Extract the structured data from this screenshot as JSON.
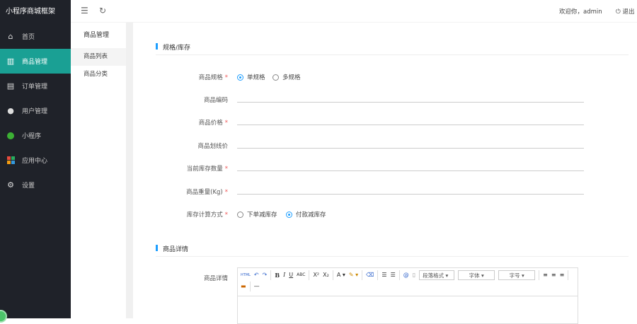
{
  "app": {
    "title": "小程序商城框架"
  },
  "sidebar": {
    "items": [
      {
        "label": "首页",
        "icon": "home-icon"
      },
      {
        "label": "商品管理",
        "icon": "gift-icon",
        "active": true
      },
      {
        "label": "订单管理",
        "icon": "order-icon"
      },
      {
        "label": "用户管理",
        "icon": "user-icon"
      },
      {
        "label": "小程序",
        "icon": "miniprogram-icon"
      },
      {
        "label": "应用中心",
        "icon": "apps-icon"
      },
      {
        "label": "设置",
        "icon": "gear-icon"
      }
    ]
  },
  "submenu": {
    "title": "商品管理",
    "items": [
      {
        "label": "商品列表",
        "active": true
      },
      {
        "label": "商品分类"
      }
    ]
  },
  "header": {
    "welcome": "欢迎你，admin",
    "logout": "退出"
  },
  "form": {
    "section1": "规格/库存",
    "spec_label": "商品规格",
    "spec_options": [
      "单规格",
      "多规格"
    ],
    "code_label": "商品编码",
    "price_label": "商品价格",
    "line_price_label": "商品划线价",
    "stock_label": "当前库存数量",
    "weight_label": "商品重量(Kg)",
    "stock_method_label": "库存计算方式",
    "stock_method_options": [
      "下单减库存",
      "付款减库存"
    ],
    "required": "*",
    "section2": "商品详情",
    "detail_label": "商品详情"
  },
  "editor": {
    "paragraph": "段落格式",
    "font": "字体",
    "size": "字号"
  }
}
